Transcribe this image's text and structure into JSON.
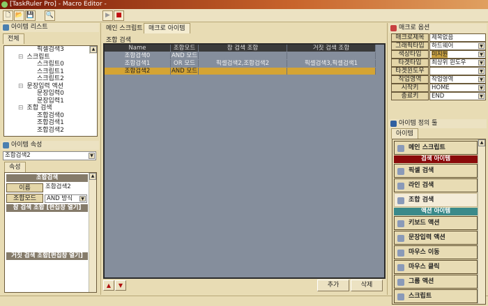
{
  "window": {
    "title": "[TaskRuler Pro] - Macro Editor -"
  },
  "toolbar": {
    "buttons": [
      {
        "name": "new",
        "glyph": "🗋"
      },
      {
        "name": "open",
        "glyph": "📂"
      },
      {
        "name": "save",
        "glyph": "💾"
      },
      {
        "name": "find",
        "glyph": "🔍"
      },
      {
        "name": "play",
        "glyph": "▶"
      },
      {
        "name": "record",
        "glyph": "■"
      }
    ]
  },
  "item_list": {
    "title": "아이템 리스트",
    "tab": "전체",
    "tree": [
      {
        "label": "픽셀검색3",
        "level": 2
      },
      {
        "label": "스크립트",
        "level": 1,
        "expander": "⊟"
      },
      {
        "label": "스크립트0",
        "level": 2
      },
      {
        "label": "스크립트1",
        "level": 2
      },
      {
        "label": "스크립트2",
        "level": 2
      },
      {
        "label": "문장입력 액션",
        "level": 1,
        "expander": "⊟"
      },
      {
        "label": "문장입력0",
        "level": 2
      },
      {
        "label": "문장입력1",
        "level": 2
      },
      {
        "label": "조합 검색",
        "level": 1,
        "expander": "⊟"
      },
      {
        "label": "조합검색0",
        "level": 2
      },
      {
        "label": "조합검색1",
        "level": 2
      },
      {
        "label": "조합검색2",
        "level": 2
      }
    ]
  },
  "item_props": {
    "title": "아이템 속성",
    "selector": "조합검색2",
    "tab": "속성",
    "section": "조합검색",
    "name_label": "이름",
    "name_value": "조합검색2",
    "mode_label": "조합모드",
    "mode_value": "AND 방식",
    "true_section": "참 검색 조합 [편집창 열기]",
    "false_section": "거짓 검색 조합[편집창 열기]"
  },
  "center": {
    "tabs": [
      {
        "label": "메인 스크립트",
        "active": false
      },
      {
        "label": "매크로 아이템",
        "active": true
      }
    ],
    "group": "조합 검색",
    "columns": [
      "Name",
      "조합모드",
      "참 검색 조합",
      "거짓 검색 조합"
    ],
    "rows": [
      [
        "조합검색0",
        "AND 모드",
        "",
        ""
      ],
      [
        "조합검색1",
        "OR 모드",
        "픽셀검색2,조합검색2",
        "픽셀검색3,픽셀검색1"
      ],
      [
        "조합검색2",
        "AND 모드",
        "",
        ""
      ]
    ],
    "selected_row": 2,
    "add_label": "추가",
    "delete_label": "삭제",
    "up_glyph": "▲",
    "down_glyph": "▼"
  },
  "macro_options": {
    "title": "매크로 옵션",
    "rows": [
      {
        "label": "매크로제목",
        "value": "제목없음",
        "dropdown": false
      },
      {
        "label": "그래픽타입",
        "value": "하드웨어",
        "dropdown": true
      },
      {
        "label": "색상타입",
        "value": "미지원",
        "dropdown": true,
        "highlight": true
      },
      {
        "label": "타겟타입",
        "value": "최상위 윈도우",
        "dropdown": true
      },
      {
        "label": "타겟윈도우",
        "value": "",
        "dropdown": true
      },
      {
        "label": "작업영역",
        "value": "작업영역",
        "dropdown": true
      },
      {
        "label": "시작키",
        "value": "HOME",
        "dropdown": true
      },
      {
        "label": "종료키",
        "value": "END",
        "dropdown": true
      }
    ]
  },
  "item_tools": {
    "title": "아이템 정의 툴",
    "tab": "아이템",
    "items": [
      {
        "type": "item",
        "label": "메인 스크립트"
      },
      {
        "type": "section",
        "label": "검색 아이템",
        "color": "#8a0a0a"
      },
      {
        "type": "item",
        "label": "픽셀 검색"
      },
      {
        "type": "item",
        "label": "라인 검색"
      },
      {
        "type": "item",
        "label": "조합 검색",
        "active": true
      },
      {
        "type": "section",
        "label": "액션 아이템",
        "color": "#3a8a8a"
      },
      {
        "type": "item",
        "label": "키보드 액션"
      },
      {
        "type": "item",
        "label": "문장입력 액션"
      },
      {
        "type": "item",
        "label": "마우스 이동"
      },
      {
        "type": "item",
        "label": "마우스 클릭"
      },
      {
        "type": "item",
        "label": "그룹 액션"
      },
      {
        "type": "item",
        "label": "스크립트"
      }
    ]
  },
  "colors": {
    "accent": "#d4a434",
    "grid_bg": "#858e9c",
    "panel_bg": "#e8dcb4"
  }
}
